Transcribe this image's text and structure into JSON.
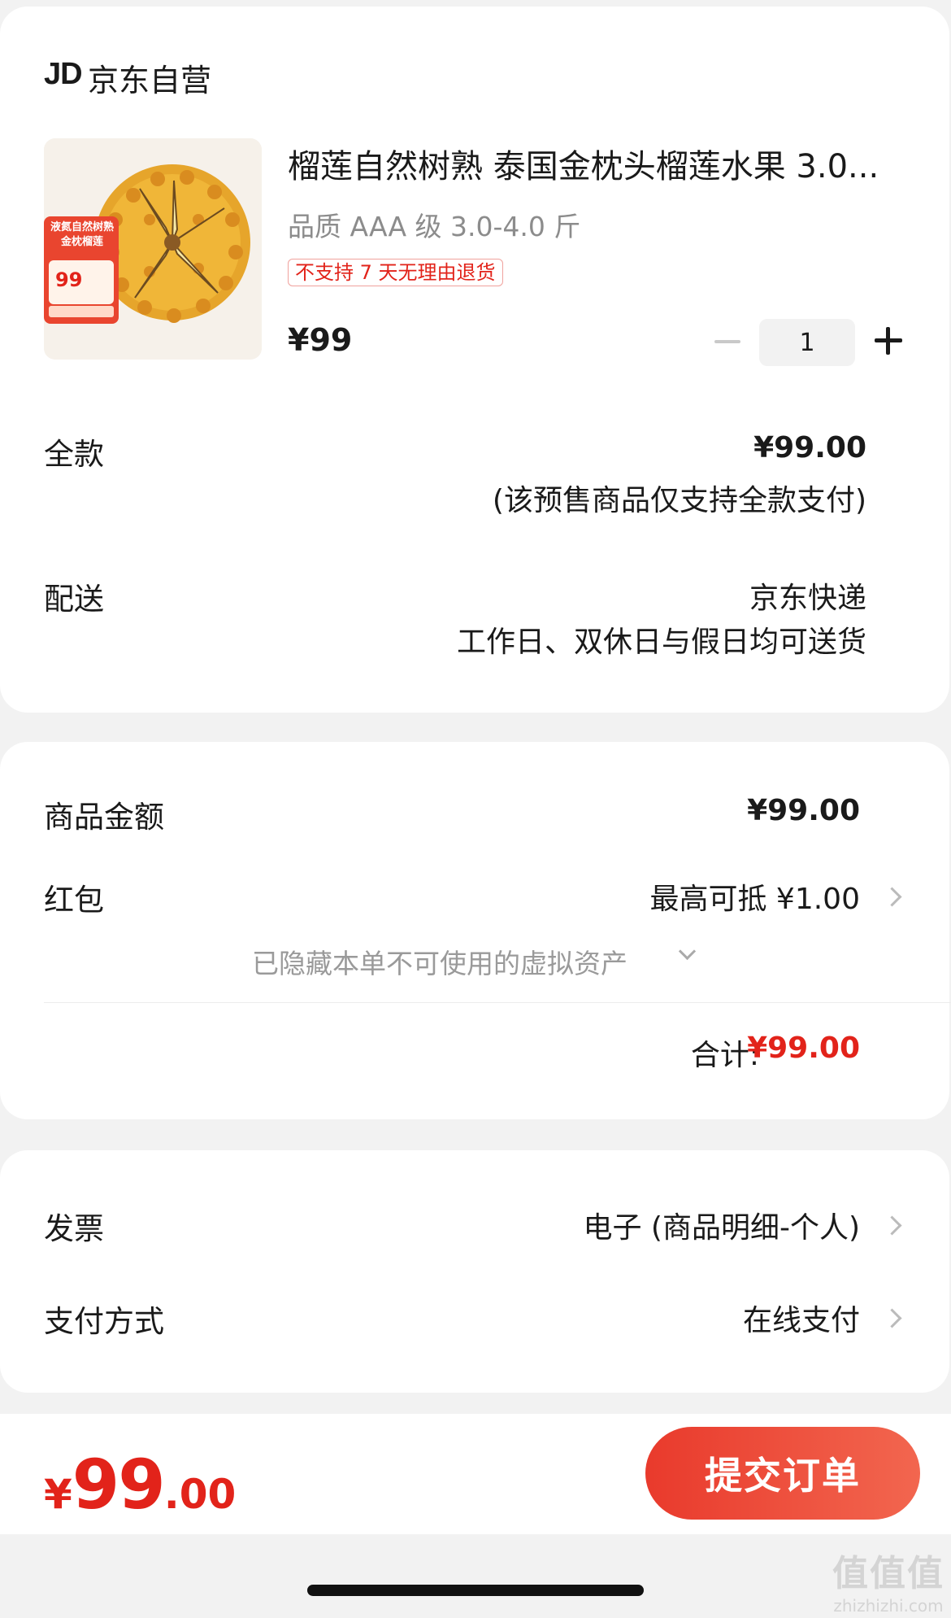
{
  "shop": {
    "logo": "JD",
    "name": "京东自营"
  },
  "product": {
    "title": "榴莲自然树熟 泰国金枕头榴莲水果 3.0...",
    "spec": "品质 AAA 级 3.0-4.0 斤",
    "return_tag": "不支持 7 天无理由退货",
    "price": "¥99",
    "quantity": "1",
    "image_badge": {
      "line1": "液氮自然树熟",
      "line2": "金枕榴莲",
      "price": "99"
    }
  },
  "payment_full": {
    "label": "全款",
    "amount": "¥99.00",
    "note": "(该预售商品仅支持全款支付)"
  },
  "delivery": {
    "label": "配送",
    "carrier": "京东快递",
    "schedule": "工作日、双休日与假日均可送货"
  },
  "summary": {
    "goods_label": "商品金额",
    "goods_amount": "¥99.00",
    "redpack_label": "红包",
    "redpack_value": "最高可抵 ¥1.00",
    "hidden_assets": "已隐藏本单不可使用的虚拟资产",
    "total_label": "合计:",
    "total_value": "¥99.00"
  },
  "invoice": {
    "label": "发票",
    "value": "电子 (商品明细-个人)"
  },
  "pay_method": {
    "label": "支付方式",
    "value": "在线支付"
  },
  "bottom": {
    "currency": "¥",
    "price_int": "99",
    "price_dec": ".00",
    "submit_label": "提交订单"
  },
  "watermark": {
    "logo": "值值值",
    "url": "zhizhizhi.com"
  },
  "colors": {
    "accent": "#e2231a",
    "button_start": "#e93a2c",
    "button_end": "#f2664f",
    "background": "#f2f2f2"
  },
  "icons": [
    "minus-icon",
    "plus-icon",
    "chevron-right-icon",
    "chevron-down-icon"
  ]
}
